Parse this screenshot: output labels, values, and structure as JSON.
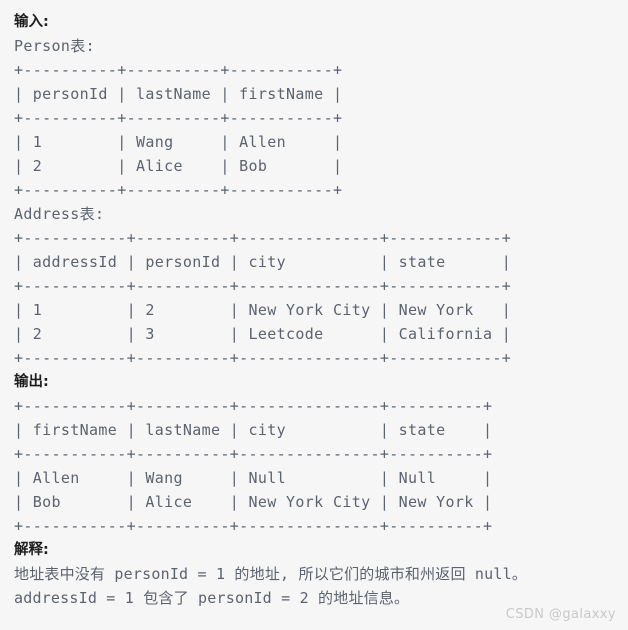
{
  "page": {
    "background_color": "#f6f6f6",
    "text_color": "#5c6370",
    "heading_color": "#1f1f1f",
    "watermark_color": "#c9c9c9"
  },
  "input": {
    "heading": "输入:",
    "person_table": {
      "caption": "Person表:",
      "columns": [
        "personId",
        "lastName",
        "firstName"
      ],
      "rows": [
        [
          "1",
          "Wang",
          "Allen"
        ],
        [
          "2",
          "Alice",
          "Bob"
        ]
      ],
      "ascii": [
        "+----------+----------+-----------+",
        "| personId | lastName | firstName |",
        "+----------+----------+-----------+",
        "| 1        | Wang     | Allen     |",
        "| 2        | Alice    | Bob       |",
        "+----------+----------+-----------+"
      ]
    },
    "address_table": {
      "caption": "Address表:",
      "columns": [
        "addressId",
        "personId",
        "city",
        "state"
      ],
      "rows": [
        [
          "1",
          "2",
          "New York City",
          "New York"
        ],
        [
          "2",
          "3",
          "Leetcode",
          "California"
        ]
      ],
      "ascii": [
        "+-----------+----------+---------------+------------+",
        "| addressId | personId | city          | state      |",
        "+-----------+----------+---------------+------------+",
        "| 1         | 2        | New York City | New York   |",
        "| 2         | 3        | Leetcode      | California |",
        "+-----------+----------+---------------+------------+"
      ]
    }
  },
  "output": {
    "heading": "输出:",
    "result_table": {
      "columns": [
        "firstName",
        "lastName",
        "city",
        "state"
      ],
      "rows": [
        [
          "Allen",
          "Wang",
          "Null",
          "Null"
        ],
        [
          "Bob",
          "Alice",
          "New York City",
          "New York"
        ]
      ],
      "ascii": [
        "+-----------+----------+---------------+----------+",
        "| firstName | lastName | city          | state    |",
        "+-----------+----------+---------------+----------+",
        "| Allen     | Wang     | Null          | Null     |",
        "| Bob       | Alice    | New York City | New York |",
        "+-----------+----------+---------------+----------+"
      ]
    }
  },
  "explanation": {
    "heading": "解释:",
    "lines": [
      "地址表中没有 personId = 1 的地址, 所以它们的城市和州返回 null。",
      "addressId = 1 包含了 personId = 2 的地址信息。"
    ]
  },
  "watermark": {
    "text": "CSDN @galaxxy"
  }
}
